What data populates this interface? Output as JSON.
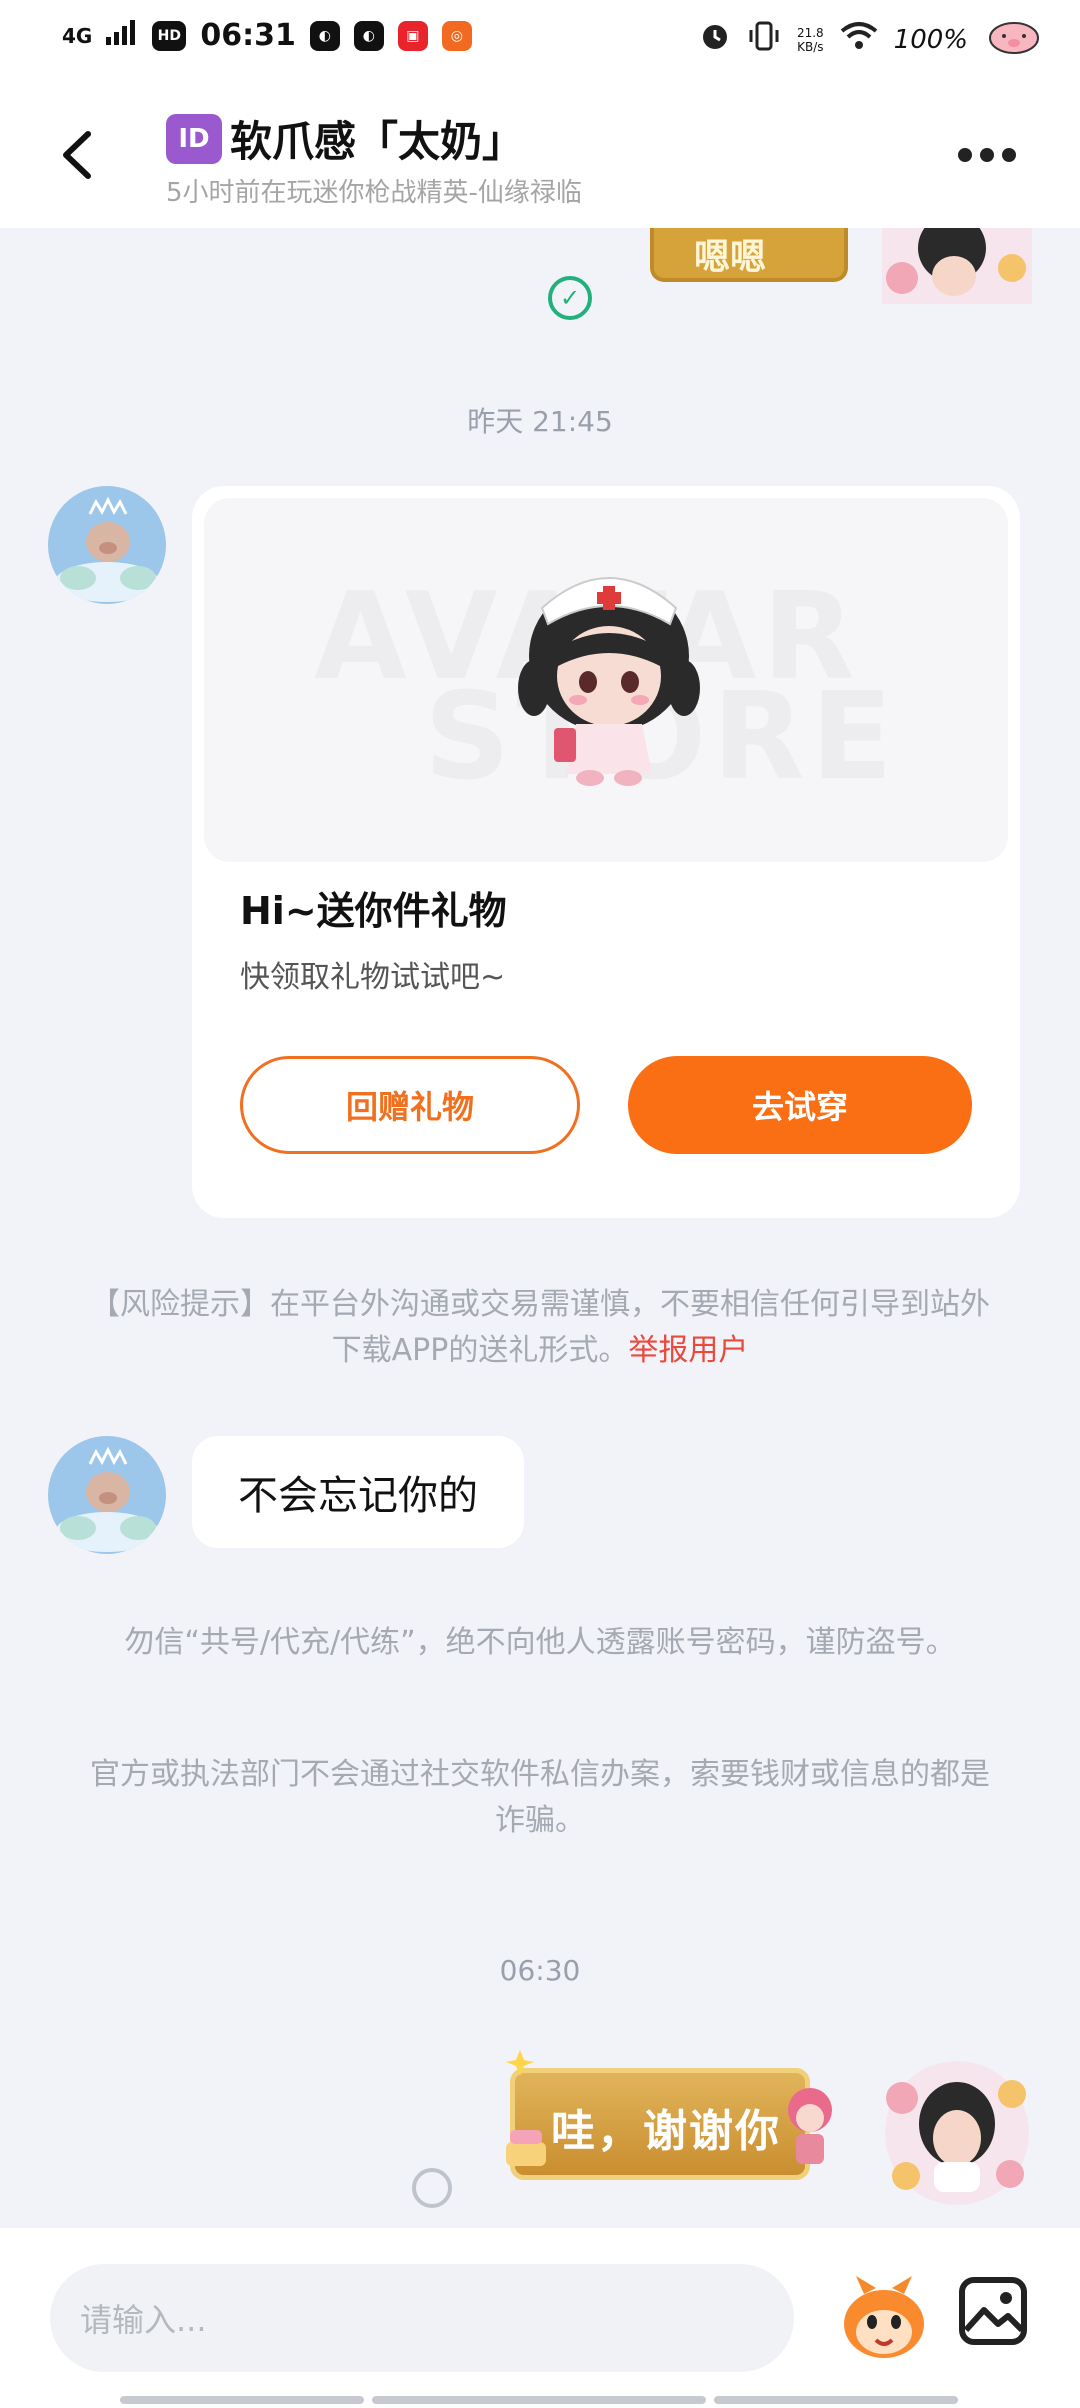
{
  "status_bar": {
    "network": "4G",
    "hd": "HD",
    "time": "06:31",
    "speed_value": "21.8",
    "speed_unit": "KB/s",
    "battery": "100%"
  },
  "header": {
    "id_badge": "ID",
    "title": "软爪感「太奶」",
    "subtitle": "5小时前在玩迷你枪战精英-仙缘禄临"
  },
  "messages": {
    "prev_sticker_text": "嗯嗯",
    "timestamp_1": "昨天 21:45",
    "gift_card": {
      "watermark_line1": "AVATAR",
      "watermark_line2": "STORE",
      "title": "Hi~送你件礼物",
      "subtitle": "快领取礼物试试吧~",
      "return_gift_label": "回赠礼物",
      "try_on_label": "去试穿"
    },
    "risk_notice": {
      "text": "【风险提示】在平台外沟通或交易需谨慎，不要相信任何引导到站外下载APP的送礼形式。",
      "report_link": "举报用户"
    },
    "text_message": "不会忘记你的",
    "security_notice_1": "勿信“共号/代充/代练”，绝不向他人透露账号密码，谨防盗号。",
    "security_notice_2": "官方或执法部门不会通过社交软件私信办案，索要钱财或信息的都是诈骗。",
    "timestamp_2": "06:30",
    "sticker_text": "哇，谢谢你"
  },
  "input": {
    "placeholder": "请输入..."
  },
  "colors": {
    "accent": "#fa6f14",
    "report_red": "#ea4a3c",
    "read_green": "#23b07a",
    "background": "#f1f3f8"
  }
}
